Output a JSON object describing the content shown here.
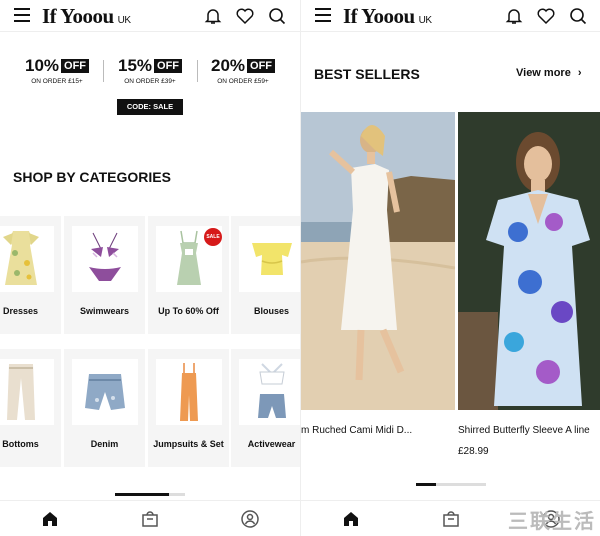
{
  "header": {
    "logo": "If Yooou",
    "region": "UK"
  },
  "promos": [
    {
      "pct": "10%",
      "off": "OFF",
      "sub": "ON ORDER £15+"
    },
    {
      "pct": "15%",
      "off": "OFF",
      "sub": "ON ORDER £39+"
    },
    {
      "pct": "20%",
      "off": "OFF",
      "sub": "ON ORDER £59+"
    }
  ],
  "code": "CODE: SALE",
  "categories_title": "SHOP BY CATEGORIES",
  "categories": [
    {
      "label": "Dresses",
      "icon": "floral-dress-icon"
    },
    {
      "label": "Swimwears",
      "icon": "bikini-icon"
    },
    {
      "label": "Up To 60% Off",
      "icon": "green-dress-icon"
    },
    {
      "label": "Blouses",
      "icon": "yellow-blouse-icon"
    },
    {
      "label": "Bottoms",
      "icon": "trousers-icon"
    },
    {
      "label": "Denim",
      "icon": "denim-shorts-icon"
    },
    {
      "label": "Jumpsuits & Set",
      "icon": "orange-jumpsuit-icon"
    },
    {
      "label": "Activewear",
      "icon": "activewear-set-icon"
    }
  ],
  "sale_badge": "SALE",
  "bestsellers": {
    "title": "BEST SELLERS",
    "view_more": "View more",
    "products": [
      {
        "name": "m Ruched Cami Midi D...",
        "price": ""
      },
      {
        "name": "Shirred Butterfly Sleeve A line",
        "price": "£28.99"
      }
    ]
  },
  "nav": [
    "home-icon",
    "bag-icon",
    "account-icon"
  ],
  "watermark": "三联生活",
  "colors": {
    "accent": "#111111",
    "sale": "#d61a1a"
  }
}
